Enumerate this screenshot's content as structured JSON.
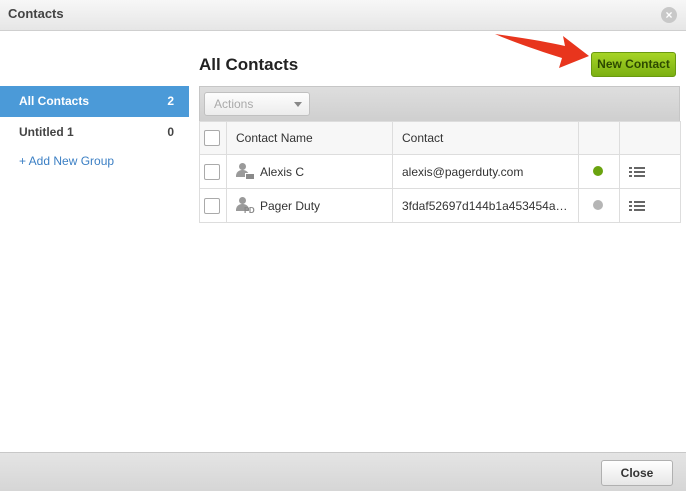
{
  "window": {
    "title": "Contacts"
  },
  "sidebar": {
    "items": [
      {
        "label": "All Contacts",
        "count": "2"
      },
      {
        "label": "Untitled 1",
        "count": "0"
      }
    ],
    "add_group_label": "+ Add New Group"
  },
  "main": {
    "title": "All Contacts",
    "new_contact_label": "New Contact",
    "actions_label": "Actions",
    "columns": {
      "name": "Contact Name",
      "contact": "Contact"
    },
    "rows": [
      {
        "name": "Alexis C",
        "contact": "alexis@pagerduty.com",
        "status_color": "#6aa30f",
        "icon": "email-contact-icon"
      },
      {
        "name": "Pager Duty",
        "contact": "3fdaf52697d144b1a453454a…",
        "status_color": "#b5b5b5",
        "icon": "pagerduty-contact-icon"
      }
    ]
  },
  "footer": {
    "close_label": "Close"
  },
  "colors": {
    "accent_blue": "#4b9ad8",
    "new_contact_green": "#8bc21a",
    "arrow_red": "#e8351d"
  }
}
